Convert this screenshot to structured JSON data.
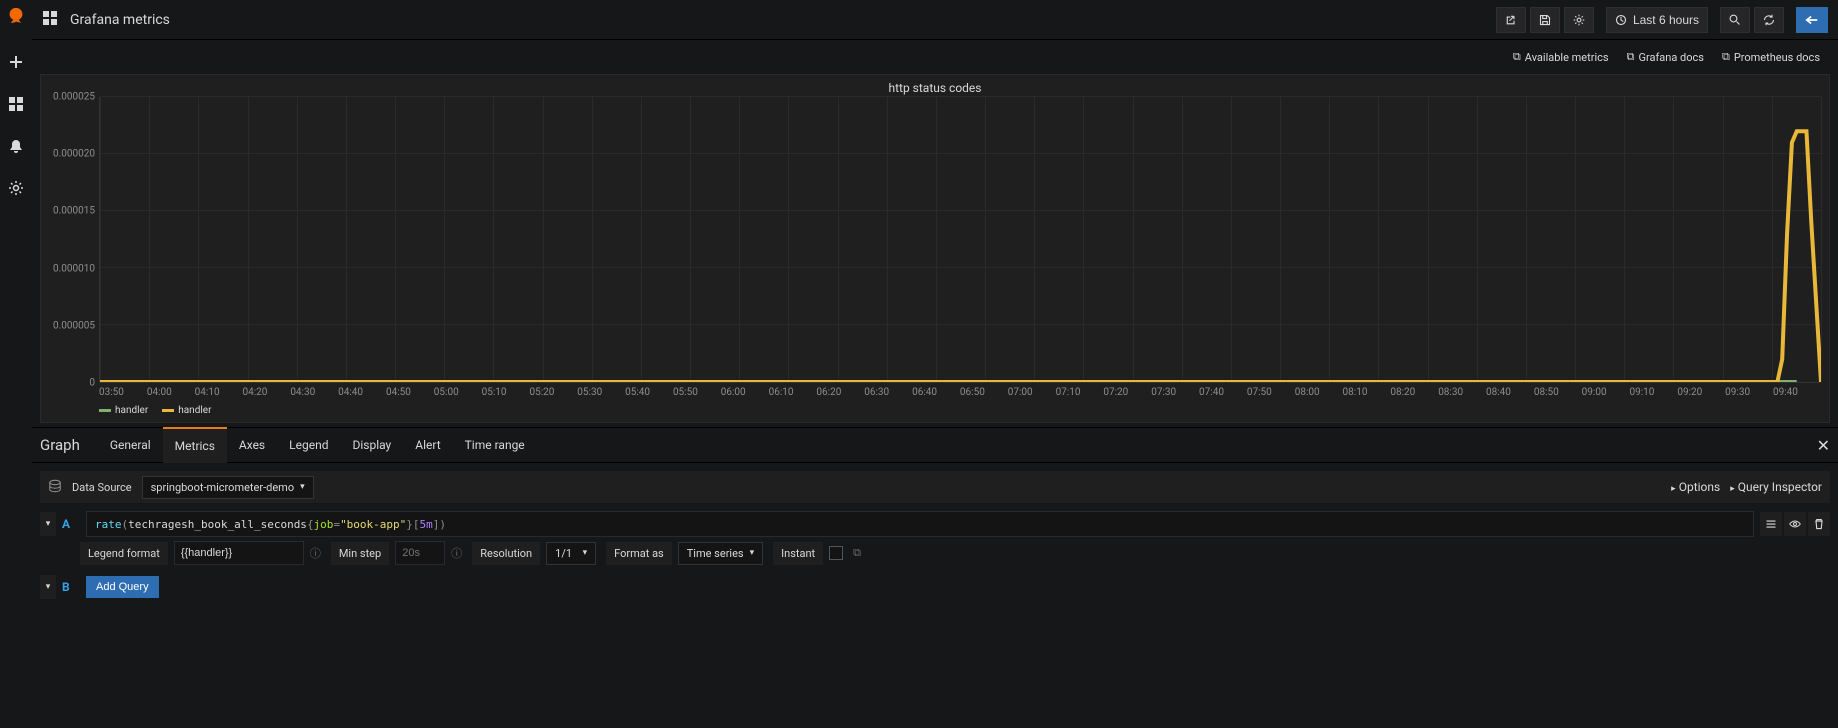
{
  "header": {
    "title": "Grafana metrics",
    "time_range": "Last 6 hours"
  },
  "doclinks": {
    "available_metrics": "Available metrics",
    "grafana_docs": "Grafana docs",
    "prometheus_docs": "Prometheus docs"
  },
  "panel": {
    "title": "http status codes"
  },
  "chart_data": {
    "type": "line",
    "title": "http status codes",
    "xlabel": "",
    "ylabel": "",
    "ylim": [
      0,
      2.5e-05
    ],
    "y_ticks": [
      "0",
      "0.000005",
      "0.000010",
      "0.000015",
      "0.000020",
      "0.000025"
    ],
    "x_ticks": [
      "03:50",
      "04:00",
      "04:10",
      "04:20",
      "04:30",
      "04:40",
      "04:50",
      "05:00",
      "05:10",
      "05:20",
      "05:30",
      "05:40",
      "05:50",
      "06:00",
      "06:10",
      "06:20",
      "06:30",
      "06:40",
      "06:50",
      "07:00",
      "07:10",
      "07:20",
      "07:30",
      "07:40",
      "07:50",
      "08:00",
      "08:10",
      "08:20",
      "08:30",
      "08:40",
      "08:50",
      "09:00",
      "09:10",
      "09:20",
      "09:30",
      "09:40"
    ],
    "series": [
      {
        "name": "handler",
        "color": "#7eb26d",
        "x": [
          "03:50",
          "09:40"
        ],
        "values": [
          0,
          0
        ]
      },
      {
        "name": "handler",
        "color": "#eab839",
        "x": [
          "03:50",
          "09:36",
          "09:37",
          "09:38",
          "09:39",
          "09:40",
          "09:41",
          "09:42",
          "09:43",
          "09:45"
        ],
        "values": [
          0,
          0,
          2e-06,
          1.3e-05,
          2.1e-05,
          2.2e-05,
          2.2e-05,
          2.2e-05,
          1.4e-05,
          0
        ]
      }
    ]
  },
  "legend": [
    {
      "label": "handler",
      "color": "#7eb26d"
    },
    {
      "label": "handler",
      "color": "#eab839"
    }
  ],
  "editor": {
    "title": "Graph",
    "tabs": [
      "General",
      "Metrics",
      "Axes",
      "Legend",
      "Display",
      "Alert",
      "Time range"
    ],
    "active_tab": "Metrics"
  },
  "datasource": {
    "label": "Data Source",
    "selected": "springboot-micrometer-demo",
    "options_label": "Options",
    "query_inspector_label": "Query Inspector"
  },
  "query_a": {
    "letter": "A",
    "expr": "rate(techragesh_book_all_seconds{job=\"book-app\"}[5m])",
    "parts": {
      "fn": "rate",
      "metric": "techragesh_book_all_seconds",
      "label_key": "job",
      "label_val": "\"book-app\"",
      "range": "5m"
    }
  },
  "query_opts": {
    "legend_format_label": "Legend format",
    "legend_format_value": "{{handler}}",
    "min_step_label": "Min step",
    "min_step_placeholder": "20s",
    "resolution_label": "Resolution",
    "resolution_value": "1/1",
    "format_as_label": "Format as",
    "format_as_value": "Time series",
    "instant_label": "Instant"
  },
  "query_b": {
    "letter": "B",
    "add_query_label": "Add Query"
  }
}
